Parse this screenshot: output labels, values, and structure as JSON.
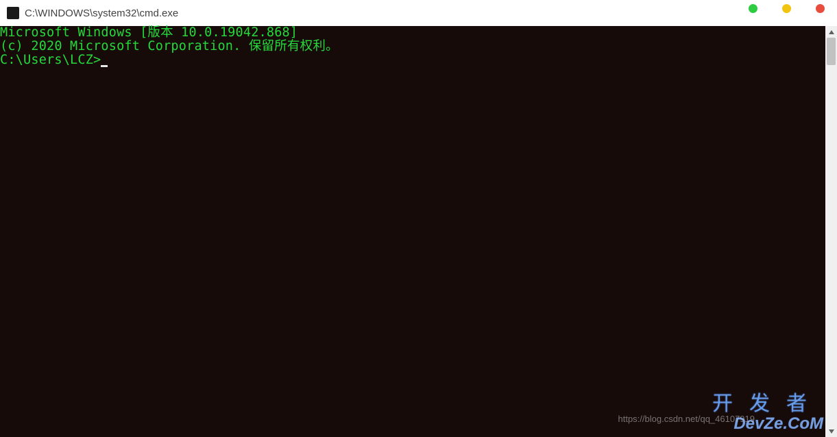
{
  "window": {
    "title": "C:\\WINDOWS\\system32\\cmd.exe"
  },
  "terminal": {
    "line1": "Microsoft Windows [版本 10.0.19042.868]",
    "line2": "(c) 2020 Microsoft Corporation. 保留所有权利。",
    "blank": "",
    "prompt": "C:\\Users\\LCZ>"
  },
  "watermark": {
    "top": "开发者",
    "url": "https://blog.csdn.net/qq_46107919",
    "brand": "DevZe.CoM"
  }
}
